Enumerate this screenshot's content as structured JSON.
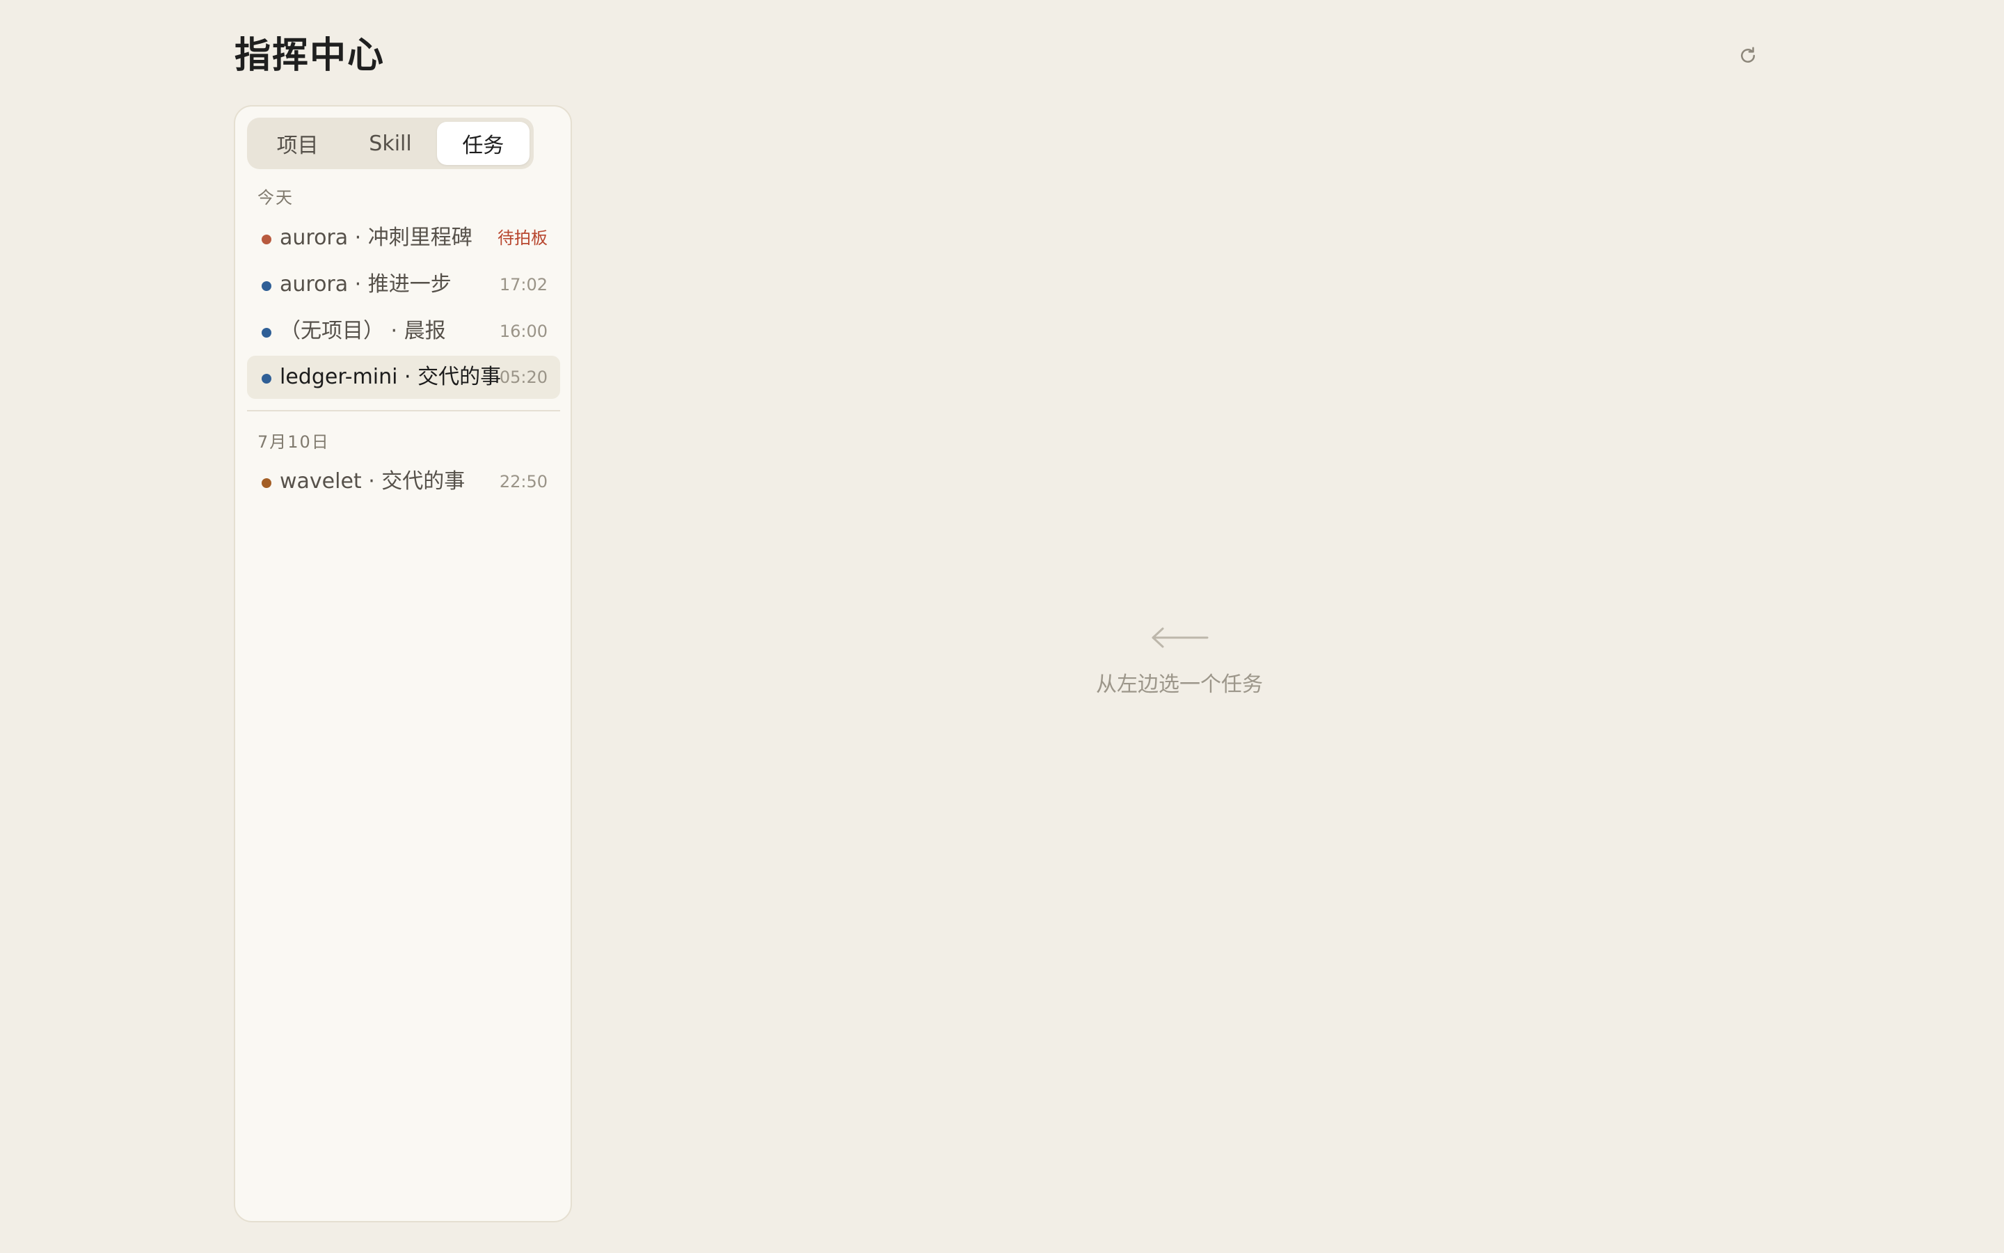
{
  "header": {
    "title": "指挥中心",
    "refresh_icon": "refresh-icon"
  },
  "sidebar": {
    "tabs": [
      {
        "label": "项目",
        "active": false
      },
      {
        "label": "Skill",
        "active": false
      },
      {
        "label": "任务",
        "active": true
      }
    ],
    "groups": [
      {
        "label": "今天",
        "tasks": [
          {
            "title": "aurora · 冲刺里程碑",
            "meta": "待拍板",
            "status_color": "#b85a3e",
            "meta_type": "alert"
          },
          {
            "title": "aurora · 推进一步",
            "meta": "17:02",
            "status_color": "#2f5f96",
            "meta_type": "time"
          },
          {
            "title": "（无项目） · 晨报",
            "meta": "16:00",
            "status_color": "#2f5f96",
            "meta_type": "time"
          },
          {
            "title": "ledger-mini · 交代的事",
            "meta": "05:20",
            "status_color": "#2f5f96",
            "meta_type": "time",
            "selected": true
          }
        ]
      },
      {
        "label": "7月10日",
        "tasks": [
          {
            "title": "wavelet · 交代的事",
            "meta": "22:50",
            "status_color": "#a35e25",
            "meta_type": "time"
          }
        ]
      }
    ]
  },
  "main": {
    "empty_icon": "arrow-left-icon",
    "empty_text": "从左边选一个任务"
  },
  "colors": {
    "background": "#f2eee6",
    "panel": "#faf8f3",
    "alert": "#b8472f"
  }
}
